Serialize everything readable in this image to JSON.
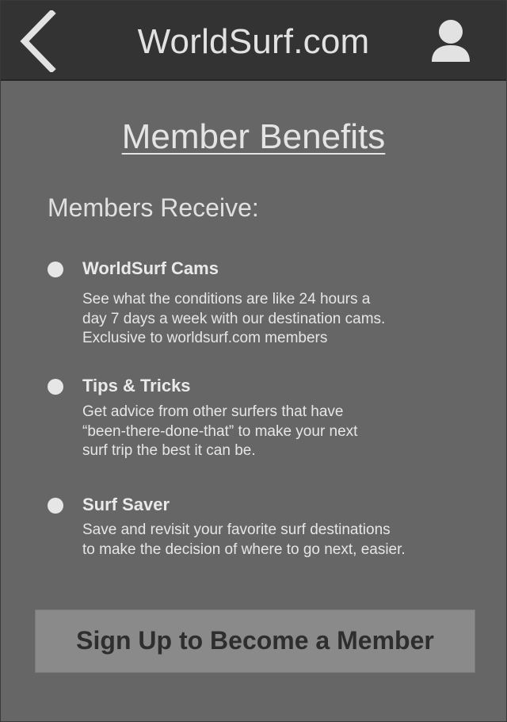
{
  "header": {
    "site_title": "WorldSurf.com",
    "back_icon": "chevron-left-icon",
    "profile_icon": "user-icon"
  },
  "page": {
    "title": "Member Benefits",
    "subtitle": "Members Receive:"
  },
  "benefits": [
    {
      "title": "WorldSurf Cams",
      "description_lines": [
        "See what the conditions are like 24 hours a",
        "day 7 days a week with our destination cams.",
        "Exclusive to worldsurf.com members"
      ]
    },
    {
      "title": "Tips & Tricks",
      "description_lines": [
        "Get advice from other surfers that have",
        "“been-there-done-that” to make your next",
        "surf trip the best it can be."
      ]
    },
    {
      "title": "Surf Saver",
      "description_lines": [
        "Save and revisit your favorite surf destinations",
        "to make the decision of where to go next, easier."
      ]
    }
  ],
  "cta": {
    "label": "Sign Up to Become a Member"
  },
  "colors": {
    "header_bg": "#333333",
    "page_bg": "#666666",
    "button_bg": "#8a8a8a",
    "text_light": "#e4e4e4",
    "button_text": "#2e2e2e"
  }
}
